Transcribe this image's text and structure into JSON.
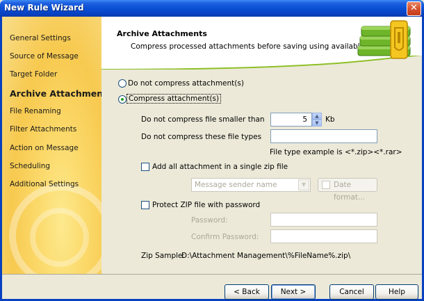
{
  "window": {
    "title": "New Rule Wizard",
    "close_glyph": "✕"
  },
  "sidebar": {
    "items": [
      {
        "label": "General Settings"
      },
      {
        "label": "Source of Message"
      },
      {
        "label": "Target Folder"
      },
      {
        "label": "Archive Attachments"
      },
      {
        "label": "File Renaming"
      },
      {
        "label": "Filter Attachments"
      },
      {
        "label": "Action on Message"
      },
      {
        "label": "Scheduling"
      },
      {
        "label": "Additional Settings"
      }
    ],
    "active_index": 3
  },
  "header": {
    "title": "Archive Attachments",
    "subtitle": "Compress processed attachments before saving using available criteria.",
    "icon": "archive-books-icon"
  },
  "options": {
    "no_compress_label": "Do not compress attachment(s)",
    "compress_label": "Compress attachment(s)",
    "selected": "compress"
  },
  "fields": {
    "min_size_label": "Do not compress file smaller than",
    "min_size_value": "5",
    "min_size_unit": "Kb",
    "file_types_label": "Do not compress these file types",
    "file_types_value": "",
    "file_type_hint": "File type example is <*.zip><*.rar>",
    "single_zip_label": "Add all attachment in a single zip file",
    "single_zip_checked": false,
    "zip_name_placeholder": "Message sender name",
    "date_format_label": "Date format...",
    "protect_zip_label": "Protect ZIP file with password",
    "protect_zip_checked": false,
    "password_label": "Password:",
    "confirm_password_label": "Confirm Password:",
    "zip_sample_label": "Zip Sample:",
    "zip_sample_value": "D:\\Attachment Management\\%FileName%.zip\\"
  },
  "buttons": {
    "back": "< Back",
    "next": "Next >",
    "cancel": "Cancel",
    "help": "Help"
  },
  "colors": {
    "titlebar": "#0a4fd6",
    "sidebar": "#f7c94f",
    "accent_green": "#8cbf26"
  }
}
